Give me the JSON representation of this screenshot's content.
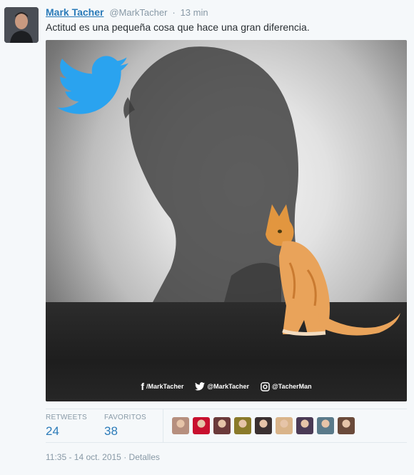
{
  "tweet": {
    "fullname": "Mark Tacher",
    "username": "@MarkTacher",
    "separator": "·",
    "time_ago": "13 min",
    "text": "Actitud es una pequeña cosa que hace una gran diferencia.",
    "media": {
      "social": [
        {
          "icon": "facebook-icon",
          "glyph": "f",
          "label": "/MarkTacher"
        },
        {
          "icon": "twitter-bird-icon",
          "glyph": "",
          "label": "@MarkTacher"
        },
        {
          "icon": "instagram-icon",
          "glyph": "",
          "label": "@TacherMan"
        }
      ]
    },
    "stats": {
      "retweets_label": "RETWEETS",
      "retweets_value": "24",
      "favorites_label": "FAVORITOS",
      "favorites_value": "38"
    },
    "favoriters": [
      {
        "color": "#b68f7e"
      },
      {
        "color": "#c8102e"
      },
      {
        "color": "#6b3a3a"
      },
      {
        "color": "#8a7a2a"
      },
      {
        "color": "#3a3030"
      },
      {
        "color": "#d9b48a"
      },
      {
        "color": "#4a3a55"
      },
      {
        "color": "#5a7a8a"
      },
      {
        "color": "#6a4a3a"
      }
    ],
    "timestamp": "11:35 - 14 oct. 2015",
    "details_label": "Detalles",
    "colors": {
      "link": "#2b7bb9",
      "muted": "#8899a6",
      "twitter_blue": "#2aa3ef"
    }
  }
}
